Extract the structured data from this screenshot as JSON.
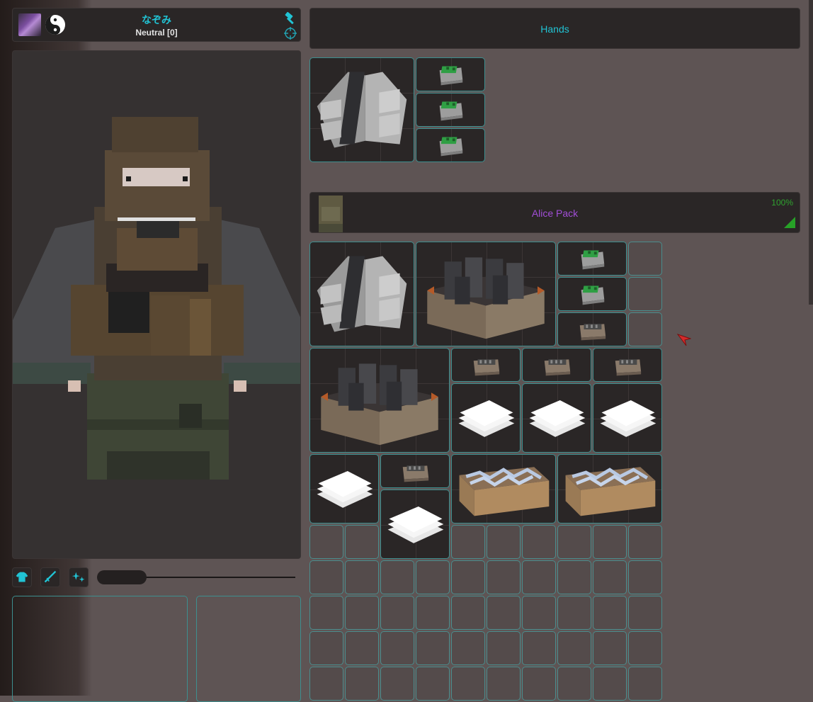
{
  "player": {
    "name": "なぞみ",
    "reputation": "Neutral [0]"
  },
  "hands": {
    "title": "Hands"
  },
  "backpack": {
    "title": "Alice Pack",
    "quality": "100%"
  },
  "icons": {
    "avatar": "avatar-image",
    "status": "yin-yang-icon",
    "skills": "hammer-icon",
    "target": "crosshair-icon",
    "tab_clothing": "shirt-icon",
    "tab_weapons": "rifle-icon",
    "tab_skills": "sparkle-icon"
  },
  "colors": {
    "player_name": "#21c3d4",
    "hands_title": "#21c3d4",
    "pack_title": "#a24ed8",
    "quality": "#2fa32f",
    "slot_border": "#3d8f8f"
  }
}
